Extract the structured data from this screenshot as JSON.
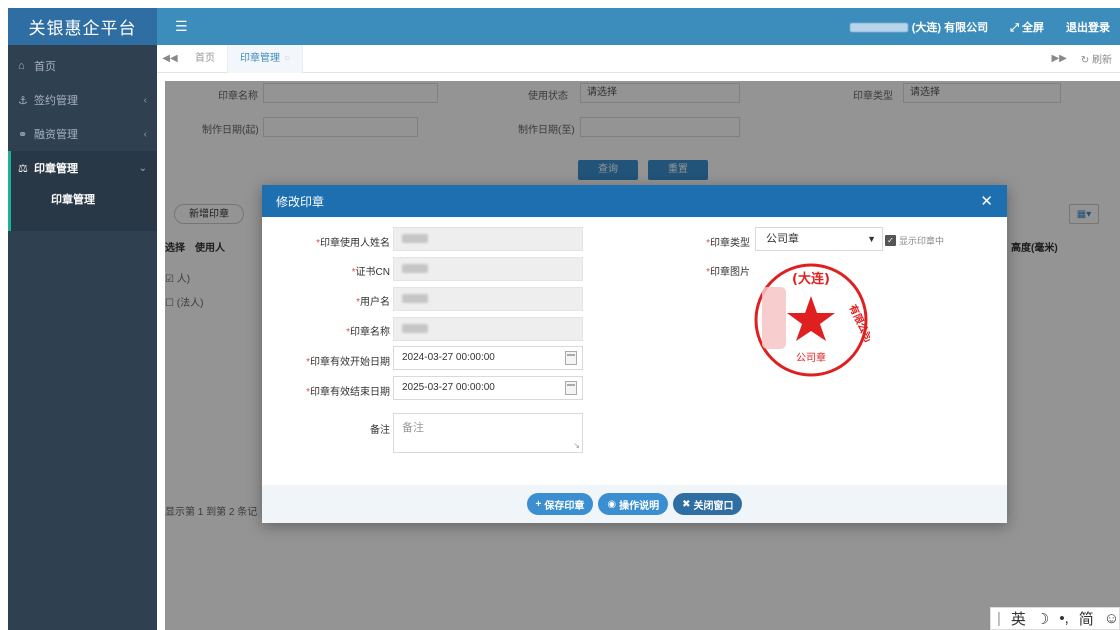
{
  "app": {
    "title": "关银惠企平台"
  },
  "topbar": {
    "company_suffix": "(大连) 有限公司",
    "fullscreen": "全屏",
    "logout": "退出登录"
  },
  "sidebar": {
    "items": [
      {
        "icon": "home-icon",
        "label": "首页"
      },
      {
        "icon": "anchor-icon",
        "label": "签约管理"
      },
      {
        "icon": "finance-icon",
        "label": "融资管理"
      },
      {
        "icon": "seal-icon",
        "label": "印章管理"
      }
    ],
    "sub_items": [
      {
        "label": "印章管理"
      }
    ]
  },
  "tabs": {
    "items": [
      {
        "label": "首页"
      },
      {
        "label": "印章管理"
      }
    ],
    "refresh": "刷新"
  },
  "search": {
    "seal_name_label": "印章名称",
    "status_label": "使用状态",
    "status_value": "请选择",
    "type_label": "印章类型",
    "type_value": "请选择",
    "date_from_label": "制作日期(起)",
    "date_to_label": "制作日期(至)",
    "query_btn": "查询",
    "reset_btn": "重置"
  },
  "table": {
    "add_btn": "新增印章",
    "headers": [
      "选择",
      "使用人"
    ],
    "rows": [
      {
        "user": "人)"
      },
      {
        "user": "(法人)"
      }
    ],
    "pager": "显示第 1 到第 2 条记",
    "height_col": "高度(毫米)"
  },
  "modal": {
    "title": "修改印章",
    "fields": {
      "user_name": {
        "label": "印章使用人姓名"
      },
      "cert_cn": {
        "label": "证书CN"
      },
      "username": {
        "label": "用户名"
      },
      "seal_name": {
        "label": "印章名称"
      },
      "start_date": {
        "label": "印章有效开始日期",
        "value": "2024-03-27 00:00:00"
      },
      "end_date": {
        "label": "印章有效结束日期",
        "value": "2025-03-27 00:00:00"
      },
      "remark": {
        "label": "备注",
        "placeholder": "备注"
      },
      "seal_type": {
        "label": "印章类型",
        "value": "公司章"
      },
      "show_in_seal": {
        "label": "显示印章中"
      },
      "seal_image": {
        "label": "印章图片"
      }
    },
    "seal_stamp": {
      "text_top": "(大连)",
      "text_right": "有限公司",
      "text_bottom": "公司章",
      "color": "#e02020"
    },
    "buttons": {
      "save": "保存印章",
      "help": "操作说明",
      "close": "关闭窗口"
    }
  },
  "ime": {
    "lang": "英",
    "mode": "简"
  }
}
